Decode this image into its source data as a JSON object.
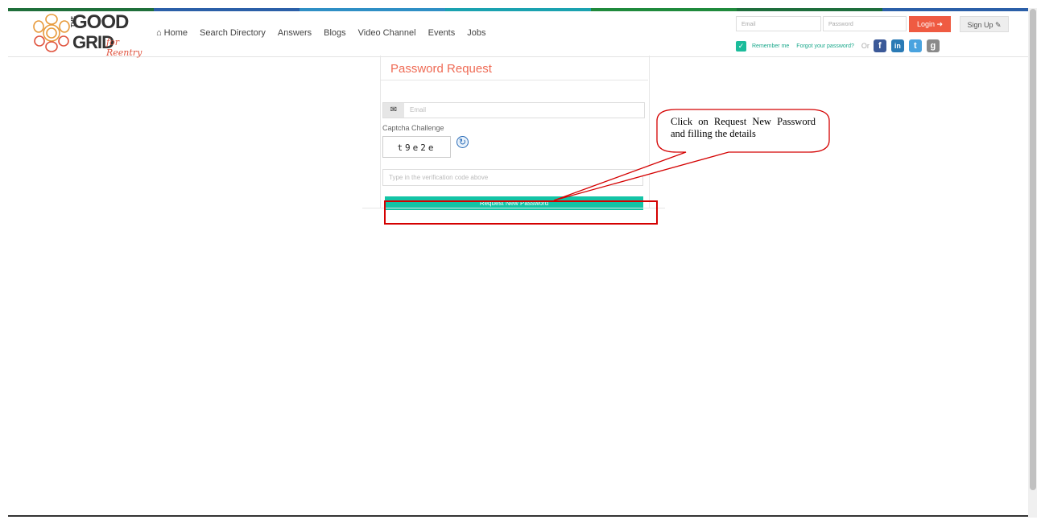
{
  "stripe_colors": [
    "#1f6f3a",
    "#2b5fa8",
    "#2f8fc5",
    "#1aa2b0",
    "#1f8a3c",
    "#1e6e3c",
    "#2b5fa8"
  ],
  "logo": {
    "line1": "GOOD",
    "the": "THE",
    "line2": "GRID",
    "tagline": "for Reentry"
  },
  "nav": {
    "home": "Home",
    "items": [
      "Search Directory",
      "Answers",
      "Blogs",
      "Video Channel",
      "Events",
      "Jobs"
    ]
  },
  "login": {
    "email_placeholder": "Email",
    "password_placeholder": "Password",
    "login_label": "Login ➜",
    "signup_label": "Sign Up ✎",
    "remember_label": "Remember me",
    "forgot_label": "Forgot your password?",
    "or_label": "Or"
  },
  "social": [
    {
      "name": "facebook",
      "glyph": "f",
      "color": "#3b5998"
    },
    {
      "name": "linkedin",
      "glyph": "in",
      "color": "#2a7ab5"
    },
    {
      "name": "twitter",
      "glyph": "t",
      "color": "#4aa3df"
    },
    {
      "name": "google",
      "glyph": "g",
      "color": "#8a8a8a"
    }
  ],
  "form": {
    "title": "Password Request",
    "email_placeholder": "Email",
    "captcha_label": "Captcha Challenge",
    "captcha_code": "t9e2e",
    "verify_placeholder": "Type in the verification code above",
    "submit_label": "Request New Password"
  },
  "callout": {
    "text": "Click on Request New Password and filling the details"
  }
}
